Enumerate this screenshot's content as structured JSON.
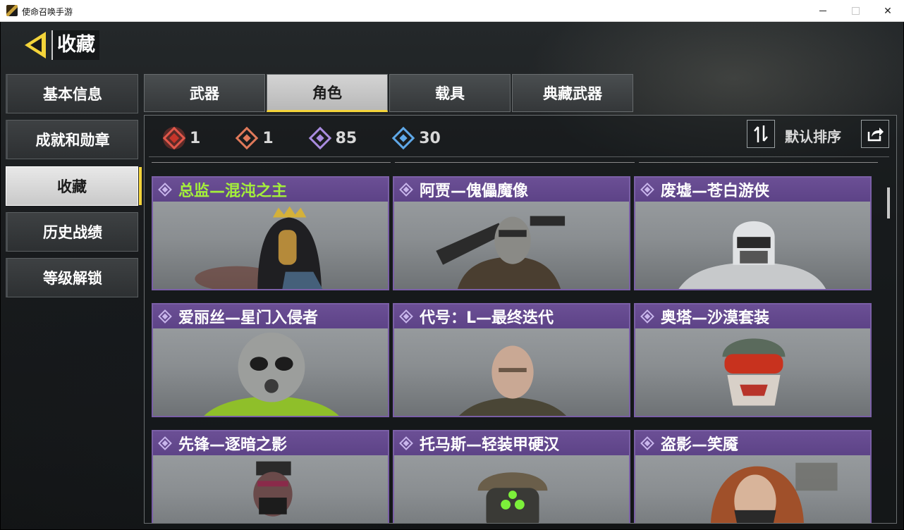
{
  "window": {
    "title": "使命召唤手游"
  },
  "header": {
    "title": "收藏"
  },
  "sidebar": {
    "items": [
      {
        "label": "基本信息",
        "active": false
      },
      {
        "label": "成就和勋章",
        "active": false
      },
      {
        "label": "收藏",
        "active": true
      },
      {
        "label": "历史战绩",
        "active": false
      },
      {
        "label": "等级解锁",
        "active": false
      }
    ]
  },
  "tabs": [
    {
      "label": "武器",
      "active": false
    },
    {
      "label": "角色",
      "active": true
    },
    {
      "label": "载具",
      "active": false
    },
    {
      "label": "典藏武器",
      "active": false
    }
  ],
  "stats": [
    {
      "icon": "mythic-rarity-icon",
      "value": "1",
      "color": "#d9463a"
    },
    {
      "icon": "legendary-rarity-icon",
      "value": "1",
      "color": "#e0795a"
    },
    {
      "icon": "epic-rarity-icon",
      "value": "85",
      "color": "#a98ce0"
    },
    {
      "icon": "rare-rarity-icon",
      "value": "30",
      "color": "#5fa8e8"
    }
  ],
  "sort": {
    "label": "默认排序"
  },
  "cards": [
    {
      "name": "总监—混沌之主",
      "legendary": true
    },
    {
      "name": "阿贾—傀儡魔像",
      "legendary": false
    },
    {
      "name": "废墟—苍白游侠",
      "legendary": false
    },
    {
      "name": "爱丽丝—星门入侵者",
      "legendary": false
    },
    {
      "name": "代号：L—最终迭代",
      "legendary": false
    },
    {
      "name": "奥塔—沙漠套装",
      "legendary": false
    },
    {
      "name": "先锋—逐暗之影",
      "legendary": false
    },
    {
      "name": "托马斯—轻装甲硬汉",
      "legendary": false
    },
    {
      "name": "盗影—笑魇",
      "legendary": false
    }
  ],
  "colors": {
    "accent": "#f4d43a",
    "card_header": "#5d4387",
    "legend_text": "#a4f03a"
  }
}
